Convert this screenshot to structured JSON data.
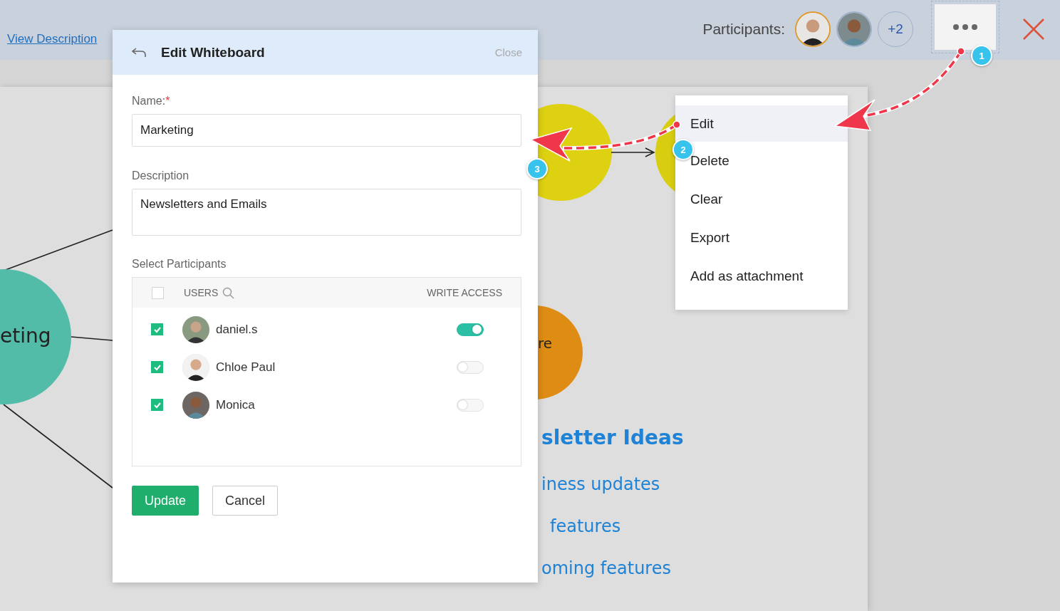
{
  "top_bar": {
    "link": "View Description",
    "participants_label": "Participants:",
    "avatars": [
      {
        "kind": "picture",
        "highlighted": true
      },
      {
        "kind": "picture",
        "highlighted": false
      }
    ],
    "more_count": "+2"
  },
  "canvas": {
    "nodes": [
      {
        "kind": "circle",
        "color": "#52bca8",
        "text": "eting"
      },
      {
        "kind": "circle",
        "color": "#ddd112"
      },
      {
        "kind": "circle",
        "color": "#d8cd10"
      },
      {
        "kind": "circle",
        "color": "#de8c14",
        "text": "re"
      }
    ],
    "heading": "sletter Ideas",
    "bullets": [
      "iness updates",
      "features",
      "oming features"
    ]
  },
  "dialog": {
    "title": "Edit Whiteboard",
    "close": "Close",
    "fields": [
      {
        "label": "Name:",
        "required_mark": "*",
        "value": "Marketing",
        "kind": "line"
      },
      {
        "label": "Description",
        "value": "Newsletters and Emails",
        "kind": "area"
      }
    ],
    "participants_label": "Select Participants",
    "table": {
      "select_all": false,
      "users_heading": "USERS",
      "access_heading": "WRITE ACCESS",
      "rows": [
        {
          "checked": true,
          "name": "daniel.s",
          "write_access": true
        },
        {
          "checked": true,
          "name": "Chloe Paul",
          "write_access": false
        },
        {
          "checked": true,
          "name": "Monica",
          "write_access": false
        }
      ]
    },
    "buttons": [
      {
        "label": "Update",
        "kind": "primary"
      },
      {
        "label": "Cancel",
        "kind": "secondary"
      }
    ]
  },
  "menu": {
    "items": [
      {
        "label": "Edit",
        "selected": true
      },
      {
        "label": "Delete",
        "selected": false
      },
      {
        "label": "Clear",
        "selected": false
      },
      {
        "label": "Export",
        "selected": false
      },
      {
        "label": "Add as attachment",
        "selected": false
      }
    ]
  },
  "annotations": [
    {
      "label": "1"
    },
    {
      "label": "2"
    },
    {
      "label": "3"
    }
  ]
}
